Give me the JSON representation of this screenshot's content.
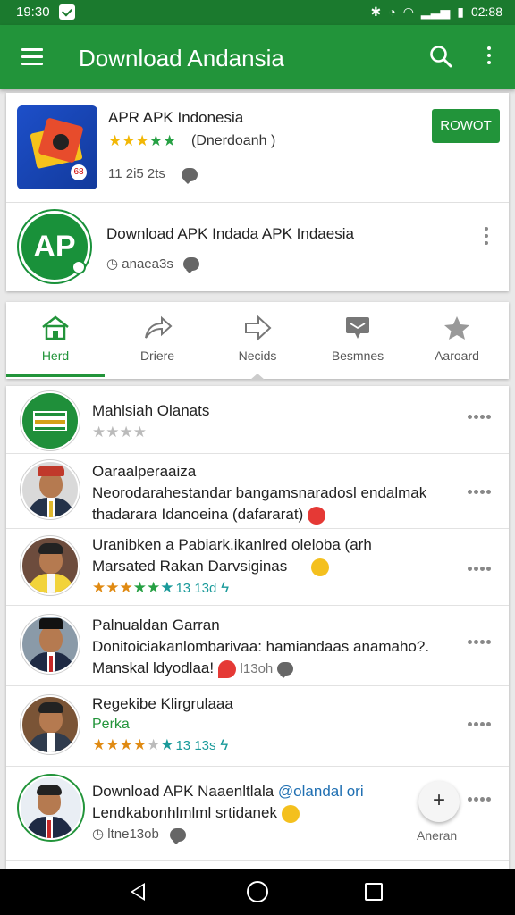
{
  "status_bar": {
    "time": "19:30",
    "time_right": "02:88"
  },
  "app_bar": {
    "title": "Download Andansia"
  },
  "top_card": {
    "item1": {
      "title": "APR APK Indonesia",
      "stars": "★★★★★",
      "rating_text": "(Dnerdoanh )",
      "meta": "11 2i5 2ts",
      "install_label": "ROWOT"
    },
    "item2": {
      "title": "Download APK Indada APK Indaesia",
      "meta": "anaea3s",
      "icon_text": "AP"
    }
  },
  "tabs": [
    {
      "label": "Herd",
      "icon": "home-icon"
    },
    {
      "label": "Driere",
      "icon": "share-icon"
    },
    {
      "label": "Necids",
      "icon": "forward-icon"
    },
    {
      "label": "Besmnes",
      "icon": "message-icon"
    },
    {
      "label": "Aaroard",
      "icon": "star-icon"
    }
  ],
  "list": [
    {
      "title": "Mahlsiah Olanats",
      "stars": [
        "e",
        "e",
        "e",
        "e"
      ]
    },
    {
      "title": "Oaraalperaaiza",
      "line1": "Neorodarahestandar bangamsnaradosl endalmak",
      "line2": "thadarara Idanoeina (dafararat)"
    },
    {
      "title": "Uranibken a Pabiark.ikanlred oleloba (arh",
      "line2": "Marsated Rakan Darvsiginas",
      "rating": "13 13d"
    },
    {
      "title": "Palnualdan Garran",
      "line1": "Donitoiciakanlombarivaa: hamiandaas anamaho?.",
      "line2": "Manskal ldyodlaa!",
      "line2_count": "l13oh"
    },
    {
      "title": "Regekibe Klirgrulaaa",
      "green": "Perka",
      "rating": "13 13s"
    },
    {
      "title": "Download APK Naaenltlala",
      "title_suffix": "@olandal ori",
      "line1": "Lendkabonhlmlml srtidanek",
      "meta": "ltne13ob"
    }
  ],
  "fab": {
    "label": "Aneran"
  }
}
